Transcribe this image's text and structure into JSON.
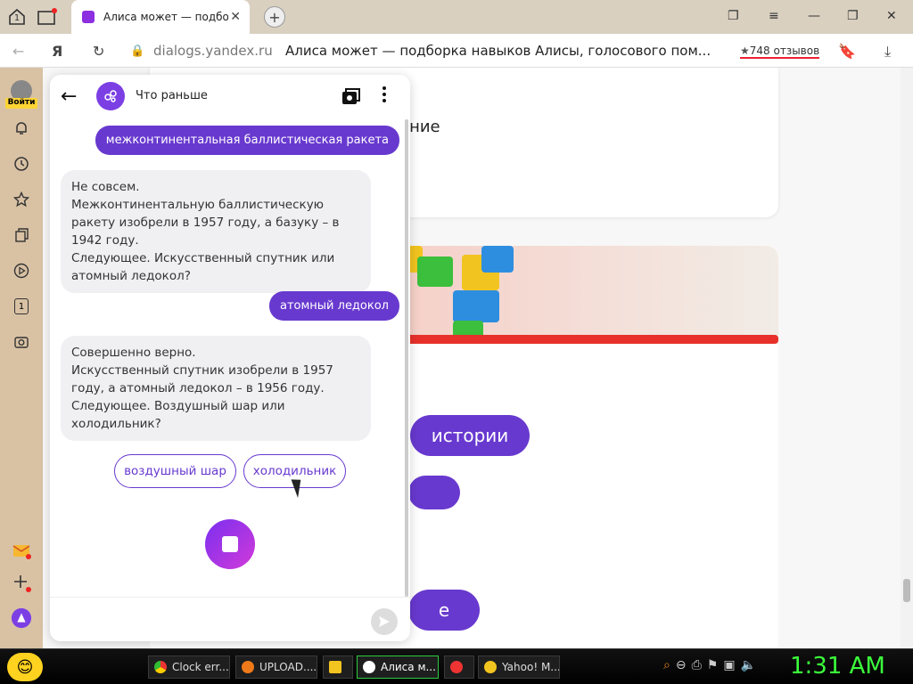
{
  "browser": {
    "tab_count_badge": "1",
    "tab_title": "Алиса может — подбор",
    "domain": "dialogs.yandex.ru",
    "page_title": "Алиса может — подборка навыков Алисы, голосового пом...",
    "reviews": "748 отзывов",
    "ya_label": "Я"
  },
  "sidebar": {
    "login_label": "Войти",
    "badge_number": "1"
  },
  "background_page": {
    "card_text": "ение",
    "cta_stories": "истории",
    "cta_bottom": "е"
  },
  "chat": {
    "title": "Что раньше",
    "messages": [
      {
        "role": "user",
        "text": "межконтинентальная баллистическая ракета"
      },
      {
        "role": "bot",
        "text": "Не совсем.\nМежконтинентальную баллистическую ракету изобрели в 1957 году, а базуку – в 1942 году.\nСледующее. Искусственный спутник или атомный ледокол?"
      },
      {
        "role": "user",
        "text": "атомный ледокол"
      },
      {
        "role": "bot",
        "text": "Совершенно верно.\nИскусственный спутник изобрели в 1957 году, а атомный ледокол – в 1956 году.\nСледующее. Воздушный шар или холодильник?"
      }
    ],
    "suggestions": [
      "воздушный шар",
      "холодильник"
    ]
  },
  "taskbar": {
    "items": [
      "Clock err...",
      "UPLOAD....",
      "",
      "Алиса м...",
      "",
      "Yahoo! M..."
    ],
    "time": "1:31 AM"
  },
  "colors": {
    "accent": "#6839cf",
    "sidebar": "#d9c2a4",
    "clock": "#3cff3c"
  }
}
